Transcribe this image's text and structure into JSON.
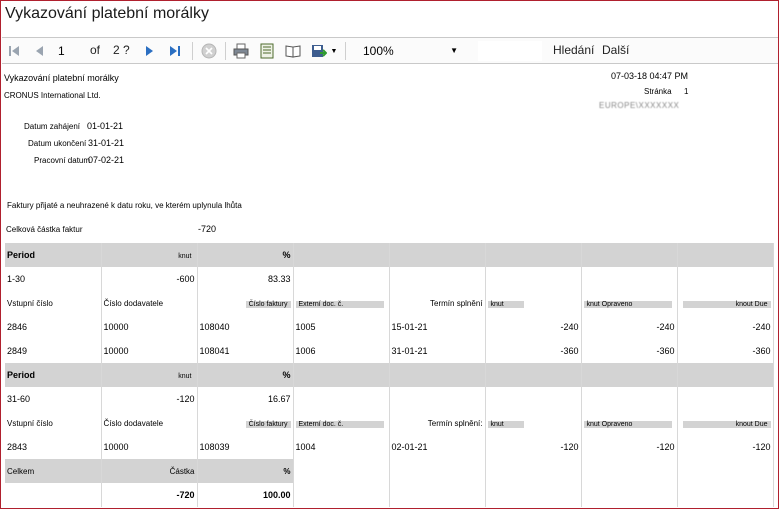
{
  "window": {
    "title": "Vykazování platební morálky"
  },
  "toolbar": {
    "page_current": "1",
    "page_of": "of",
    "page_total": "2 ?",
    "zoom_value": "100%",
    "find_label": "Hledání",
    "next_label": "Další"
  },
  "icons": [
    "first-page-icon",
    "prev-page-icon",
    "next-page-icon",
    "last-page-icon",
    "stop-icon",
    "print-icon",
    "page-setup-icon",
    "print-layout-icon",
    "export-icon"
  ],
  "report": {
    "title": "Vykazování platební morálky",
    "company": "CRONUS International Ltd.",
    "datetime": "07-03-18 04:47 PM",
    "page_label": "Stránka",
    "page_number": "1",
    "user": "EUROPE\\XXXXXXX",
    "params": [
      {
        "label": "Datum zahájení",
        "value": "01-01-21"
      },
      {
        "label": "Datum ukončení",
        "value": "31-01-21"
      },
      {
        "label": "Pracovní datum",
        "value": "07-02-21"
      }
    ],
    "description": "Faktury přijaté a neuhrazené k datu roku, ve kterém uplynula lhůta",
    "total_label": "Celková částka faktur",
    "total_value": "-720",
    "sections": [
      {
        "period_label": "Period",
        "amount_label": "knut",
        "percent_label": "%",
        "period": "1-30",
        "amount": "-600",
        "percent": "83.33",
        "headers": [
          "Vstupní číslo",
          "Číslo dodavatele",
          "Číslo faktury",
          "Externí doc. č.",
          "Termín splnění",
          "knut",
          "knut Opraveno",
          "knout Due"
        ],
        "rows": [
          [
            "2846",
            "10000",
            "108040",
            "1005",
            "15-01-21",
            "-240",
            "-240",
            "-240"
          ],
          [
            "2849",
            "10000",
            "108041",
            "1006",
            "31-01-21",
            "-360",
            "-360",
            "-360"
          ]
        ]
      },
      {
        "period_label": "Period",
        "amount_label": "knut",
        "percent_label": "%",
        "period": "31-60",
        "amount": "-120",
        "percent": "16.67",
        "headers": [
          "Vstupní číslo",
          "Číslo dodavatele",
          "Číslo faktury",
          "Externí doc. č.",
          "Termín splnění:",
          "knut",
          "knut Opraveno",
          "knout Due"
        ],
        "rows": [
          [
            "2843",
            "10000",
            "108039",
            "1004",
            "02-01-21",
            "-120",
            "-120",
            "-120"
          ]
        ]
      }
    ],
    "footer": {
      "total_label": "Celkem",
      "amount_label": "Částka",
      "percent_label": "%",
      "amount": "-720",
      "percent": "100.00"
    }
  }
}
